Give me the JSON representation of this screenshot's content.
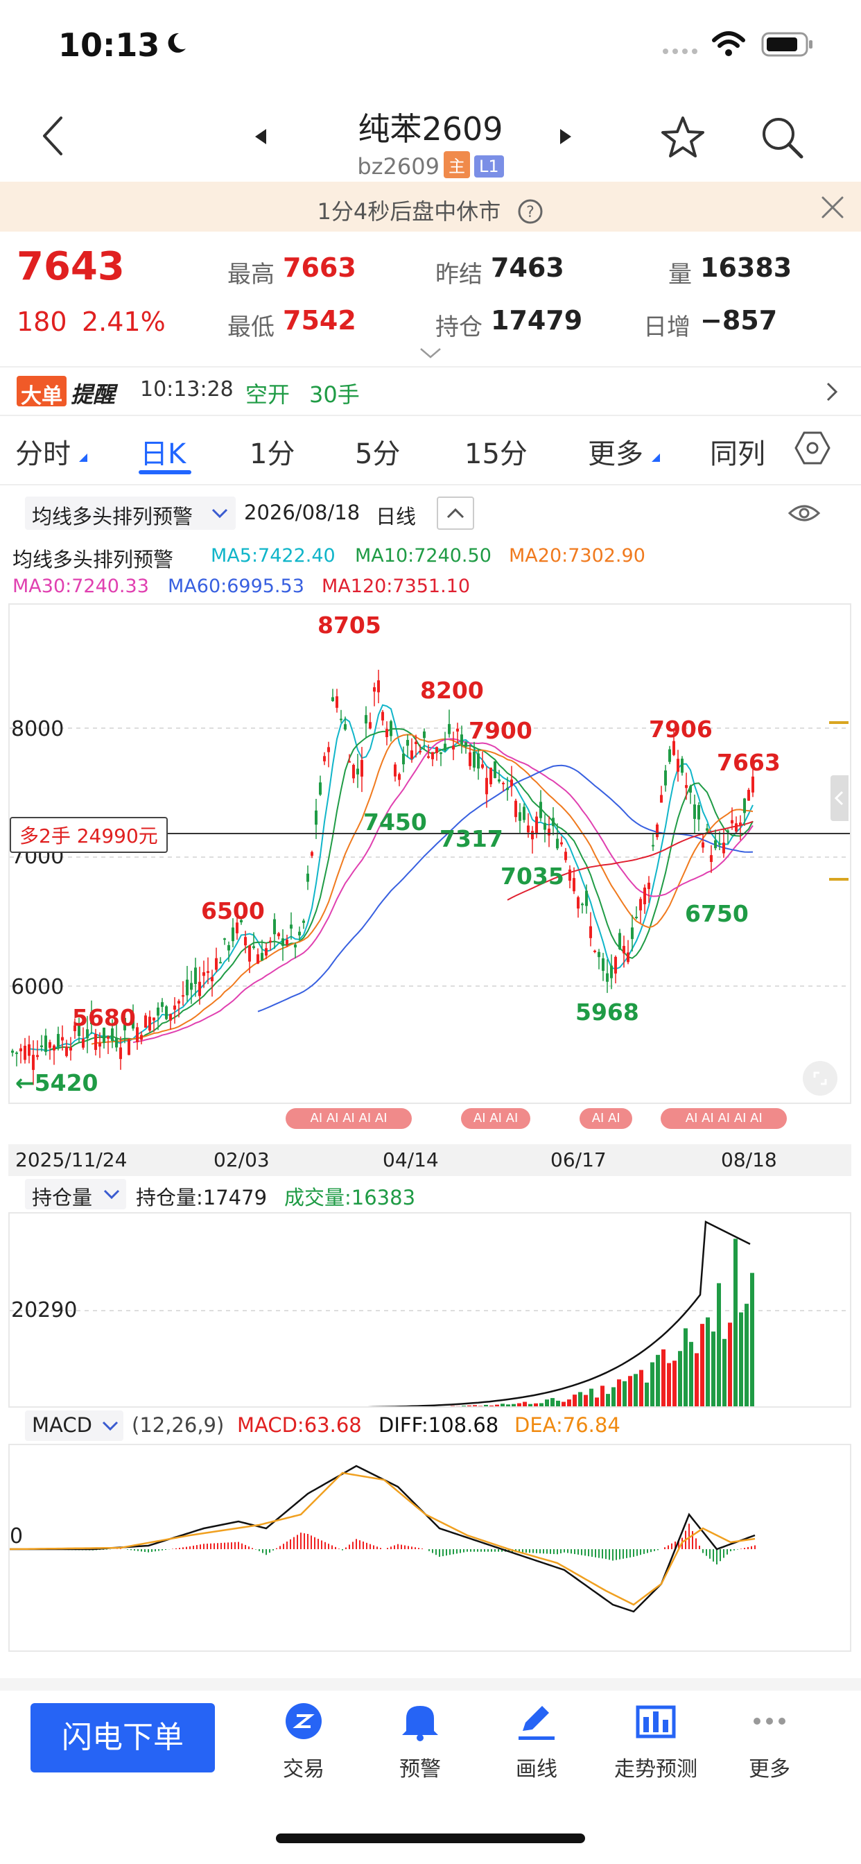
{
  "status": {
    "time": "10:13"
  },
  "header": {
    "title": "纯苯2609",
    "code": "bz2609",
    "badge_main": "主",
    "badge_level": "L1"
  },
  "banner": {
    "text": "1分4秒后盘中休市"
  },
  "quote": {
    "price": "7643",
    "change": "180",
    "change_pct": "2.41%",
    "high_label": "最高",
    "high": "7663",
    "low_label": "最低",
    "low": "7542",
    "prev_label": "昨结",
    "prev": "7463",
    "oi_label": "持仓",
    "oi": "17479",
    "vol_label": "量",
    "vol": "16383",
    "daily_label": "日增",
    "daily": "−857"
  },
  "alert": {
    "tag1": "大单",
    "tag2": "提醒",
    "time": "10:13:28",
    "type": "空开",
    "qty": "30手"
  },
  "tabs": [
    "分时",
    "日K",
    "1分",
    "5分",
    "15分",
    "更多",
    "同列"
  ],
  "indicator": {
    "name": "均线多头排列预警",
    "date": "2026/08/18",
    "period": "日线"
  },
  "ma_title": "均线多头排列预警",
  "ma": {
    "ma5": "MA5:7422.40",
    "ma10": "MA10:7240.50",
    "ma20": "MA20:7302.90",
    "ma30": "MA30:7240.33",
    "ma60": "MA60:6995.53",
    "ma120": "MA120:7351.10"
  },
  "colors": {
    "ma5": "#10b5c9",
    "ma10": "#1f9b45",
    "ma20": "#f07a1e",
    "ma30": "#e040b0",
    "ma60": "#3860e0",
    "ma120": "#e02030",
    "up": "#f02020",
    "down": "#1f9b45"
  },
  "price_chart": {
    "axis": [
      "8000",
      "7000",
      "6000"
    ],
    "position": "多2手 24990元",
    "high_labels": [
      "8705",
      "8200",
      "7900",
      "7906",
      "7663",
      "6500",
      "5680"
    ],
    "low_labels": [
      "7450",
      "7317",
      "7035",
      "6750",
      "5968",
      "←5420"
    ]
  },
  "dates": [
    "2025/11/24",
    "02/03",
    "04/14",
    "06/17",
    "08/18"
  ],
  "volume": {
    "selector": "持仓量",
    "oi_text": "持仓量:17479",
    "vol_text": "成交量:16383",
    "axis": "20290"
  },
  "macd": {
    "selector": "MACD",
    "params": "(12,26,9)",
    "macd": "MACD:63.68",
    "diff": "DIFF:108.68",
    "dea": "DEA:76.84",
    "axis": "0"
  },
  "bottom": {
    "order_button": "闪电下单",
    "items": [
      "交易",
      "预警",
      "画线",
      "走势预测",
      "更多"
    ]
  }
}
